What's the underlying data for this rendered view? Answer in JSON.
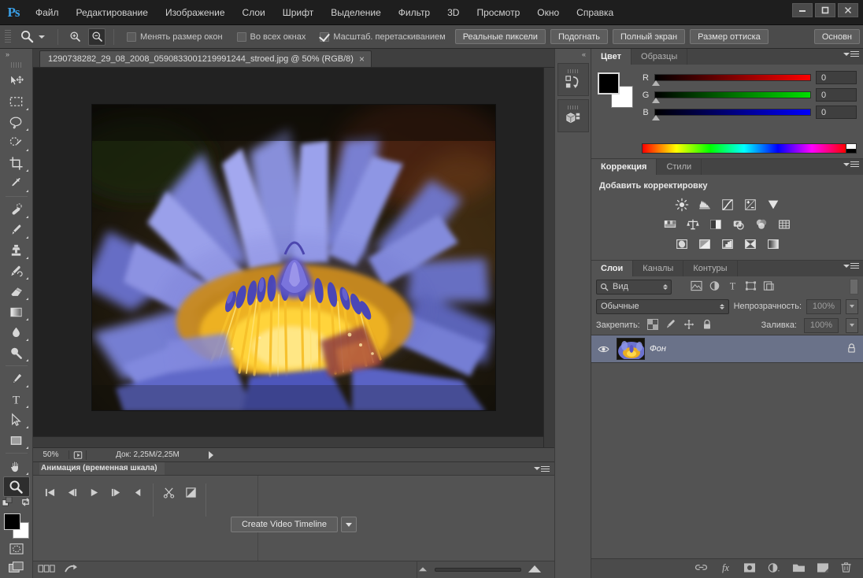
{
  "app": {
    "logo": "Ps"
  },
  "menubar": {
    "items": [
      {
        "label": "Файл"
      },
      {
        "label": "Редактирование"
      },
      {
        "label": "Изображение"
      },
      {
        "label": "Слои"
      },
      {
        "label": "Шрифт"
      },
      {
        "label": "Выделение"
      },
      {
        "label": "Фильтр"
      },
      {
        "label": "3D"
      },
      {
        "label": "Просмотр"
      },
      {
        "label": "Окно"
      },
      {
        "label": "Справка"
      }
    ],
    "window_controls": {
      "minimize": "—",
      "maximize": "❐",
      "close": "✕"
    }
  },
  "options_bar": {
    "tool_icon": "zoom-tool-icon",
    "zoom_in_label": "zoom-in-icon",
    "zoom_out_label": "zoom-out-icon",
    "checkboxes": [
      {
        "label": "Менять размер окон",
        "checked": false
      },
      {
        "label": "Во всех окнах",
        "checked": false
      },
      {
        "label": "Масштаб. перетаскиванием",
        "checked": true
      }
    ],
    "buttons": [
      {
        "label": "Реальные пиксели"
      },
      {
        "label": "Подогнать"
      },
      {
        "label": "Полный экран"
      },
      {
        "label": "Размер оттиска"
      }
    ],
    "workspace_label": "Основн"
  },
  "toolbar": {
    "tools": [
      {
        "name": "move-tool",
        "icon": "move"
      },
      {
        "name": "marquee-tool",
        "icon": "marquee"
      },
      {
        "name": "lasso-tool",
        "icon": "lasso"
      },
      {
        "name": "quick-selection-tool",
        "icon": "quickselect"
      },
      {
        "name": "crop-tool",
        "icon": "crop"
      },
      {
        "name": "eyedropper-tool",
        "icon": "eyedropper"
      },
      {
        "name": "healing-brush-tool",
        "icon": "healing"
      },
      {
        "name": "brush-tool",
        "icon": "brush"
      },
      {
        "name": "clone-stamp-tool",
        "icon": "stamp"
      },
      {
        "name": "history-brush-tool",
        "icon": "historybrush"
      },
      {
        "name": "eraser-tool",
        "icon": "eraser"
      },
      {
        "name": "gradient-tool",
        "icon": "gradient"
      },
      {
        "name": "blur-tool",
        "icon": "blur"
      },
      {
        "name": "dodge-tool",
        "icon": "dodge"
      },
      {
        "name": "pen-tool",
        "icon": "pen"
      },
      {
        "name": "type-tool",
        "icon": "type"
      },
      {
        "name": "path-selection-tool",
        "icon": "pathselect"
      },
      {
        "name": "rectangle-tool",
        "icon": "rectangle"
      },
      {
        "name": "hand-tool",
        "icon": "hand"
      },
      {
        "name": "zoom-tool",
        "icon": "zoom",
        "selected": true
      }
    ],
    "foreground_color": "#000000",
    "background_color": "#ffffff"
  },
  "document": {
    "tab_title": "1290738282_29_08_2008_0590833001219991244_stroed.jpg @ 50% (RGB/8)",
    "close_label": "×"
  },
  "status_bar": {
    "zoom": "50%",
    "doc_info": "Док: 2,25M/2,25M"
  },
  "timeline": {
    "panel_title": "Анимация (временная шкала)",
    "create_button": "Create Video Timeline",
    "controls": [
      {
        "name": "first-frame-button"
      },
      {
        "name": "previous-frame-button"
      },
      {
        "name": "play-button"
      },
      {
        "name": "next-frame-button"
      },
      {
        "name": "audio-button"
      }
    ],
    "edit_controls": [
      {
        "name": "split-clip-button"
      },
      {
        "name": "transition-button"
      }
    ]
  },
  "color_panel": {
    "tabs": [
      {
        "label": "Цвет",
        "active": true
      },
      {
        "label": "Образцы",
        "active": false
      }
    ],
    "sliders": [
      {
        "label": "R",
        "value": "0"
      },
      {
        "label": "G",
        "value": "0"
      },
      {
        "label": "B",
        "value": "0"
      }
    ],
    "foreground": "#000000",
    "background": "#ffffff"
  },
  "adjustments_panel": {
    "tabs": [
      {
        "label": "Коррекция",
        "active": true
      },
      {
        "label": "Стили",
        "active": false
      }
    ],
    "title": "Добавить корректировку",
    "row1": [
      "brightness-contrast-icon",
      "levels-icon",
      "curves-icon",
      "exposure-icon",
      "vibrance-icon"
    ],
    "row2": [
      "hue-saturation-icon",
      "color-balance-icon",
      "black-white-icon",
      "photo-filter-icon",
      "channel-mixer-icon",
      "color-lookup-icon"
    ],
    "row3": [
      "invert-icon",
      "posterize-icon",
      "threshold-icon",
      "selective-color-icon",
      "gradient-map-icon"
    ]
  },
  "layers_panel": {
    "tabs": [
      {
        "label": "Слои",
        "active": true
      },
      {
        "label": "Каналы",
        "active": false
      },
      {
        "label": "Контуры",
        "active": false
      }
    ],
    "filter_placeholder": "Вид",
    "blend_mode": "Обычные",
    "opacity_label": "Непрозрачность:",
    "opacity_value": "100%",
    "lock_label": "Закрепить:",
    "fill_label": "Заливка:",
    "fill_value": "100%",
    "layers": [
      {
        "name": "Фон",
        "visible": true,
        "locked": true,
        "selected": true
      }
    ],
    "bottom_buttons": [
      {
        "name": "link-layers-button",
        "glyph": "link"
      },
      {
        "name": "layer-style-button",
        "glyph": "fx"
      },
      {
        "name": "add-mask-button",
        "glyph": "mask"
      },
      {
        "name": "new-adjustment-layer-button",
        "glyph": "adjust"
      },
      {
        "name": "new-group-button",
        "glyph": "folder"
      },
      {
        "name": "new-layer-button",
        "glyph": "newlayer"
      },
      {
        "name": "delete-layer-button",
        "glyph": "trash"
      }
    ]
  },
  "right_mini_dock": {
    "items": [
      {
        "name": "history-panel-icon"
      },
      {
        "name": "3d-panel-icon"
      }
    ]
  },
  "colors": {
    "panel_bg": "#535353",
    "header_bg": "#1e1e1e",
    "canvas_bg": "#222222",
    "selected_layer": "#6a7289",
    "accent": "#3aa0e8"
  }
}
